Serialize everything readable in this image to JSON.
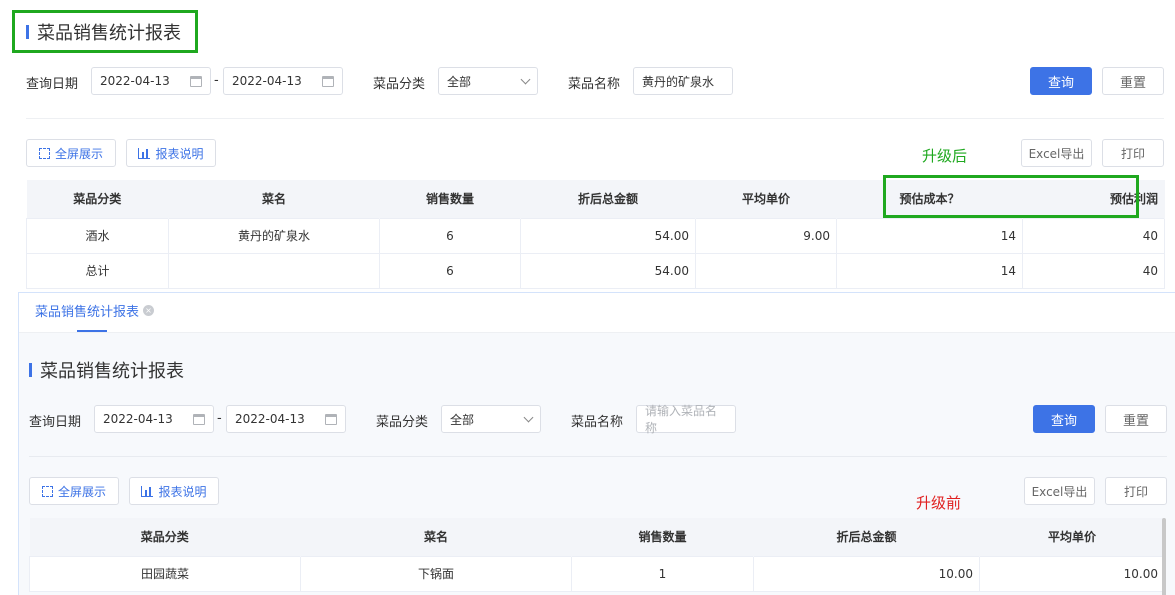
{
  "top": {
    "title": "菜品销售统计报表",
    "filters": {
      "date_label": "查询日期",
      "date_from": "2022-04-13",
      "date_sep": "-",
      "date_to": "2022-04-13",
      "category_label": "菜品分类",
      "category_value": "全部",
      "name_label": "菜品名称",
      "name_value": "黄丹的矿泉水"
    },
    "buttons": {
      "query": "查询",
      "reset": "重置",
      "fullscreen": "全屏展示",
      "report_desc": "报表说明",
      "export": "Excel导出",
      "print": "打印"
    },
    "annotation": "升级后",
    "table": {
      "columns": [
        "菜品分类",
        "菜名",
        "销售数量",
        "折后总金额",
        "平均单价",
        "预估成本？",
        "预估利润"
      ],
      "rows": [
        [
          "酒水",
          "黄丹的矿泉水",
          "6",
          "54.00",
          "9.00",
          "14",
          "40"
        ],
        [
          "总计",
          "",
          "6",
          "54.00",
          "",
          "14",
          "40"
        ]
      ]
    }
  },
  "bottom": {
    "tab_label": "菜品销售统计报表",
    "tab_close": "×",
    "title": "菜品销售统计报表",
    "filters": {
      "date_label": "查询日期",
      "date_from": "2022-04-13",
      "date_sep": "-",
      "date_to": "2022-04-13",
      "category_label": "菜品分类",
      "category_value": "全部",
      "name_label": "菜品名称",
      "name_placeholder": "请输入菜品名称"
    },
    "buttons": {
      "query": "查询",
      "reset": "重置",
      "fullscreen": "全屏展示",
      "report_desc": "报表说明",
      "export": "Excel导出",
      "print": "打印"
    },
    "annotation": "升级前",
    "table": {
      "columns": [
        "菜品分类",
        "菜名",
        "销售数量",
        "折后总金额",
        "平均单价"
      ],
      "rows": [
        [
          "田园蔬菜",
          "下锅面",
          "1",
          "10.00",
          "10.00"
        ]
      ]
    }
  },
  "colors": {
    "accent": "#3d73e6",
    "annotation_green": "#1fa81f",
    "annotation_red": "#e02020"
  }
}
